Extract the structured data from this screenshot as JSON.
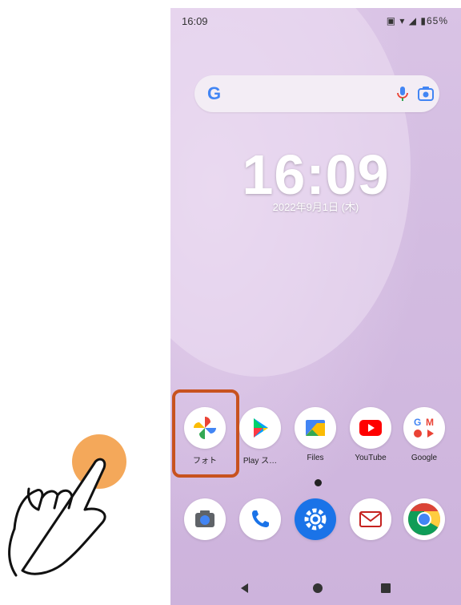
{
  "status_bar": {
    "time": "16:09",
    "battery": "65%"
  },
  "search_bar": {
    "logo_text": "G",
    "icons": [
      "mic-icon",
      "lens-camera-icon"
    ]
  },
  "clock": {
    "time": "16:09",
    "date": "2022年9月1日 (木)"
  },
  "dock_row1": [
    {
      "label": "フォト",
      "icon": "google-photos-icon"
    },
    {
      "label": "Play ス…",
      "icon": "play-store-icon"
    },
    {
      "label": "Files",
      "icon": "files-icon"
    },
    {
      "label": "YouTube",
      "icon": "youtube-icon"
    },
    {
      "label": "Google",
      "icon": "google-folder-icon"
    }
  ],
  "dock_row2": [
    {
      "icon": "camera-icon"
    },
    {
      "icon": "phone-icon"
    },
    {
      "icon": "settings-icon"
    },
    {
      "icon": "mail-icon"
    },
    {
      "icon": "chrome-icon"
    }
  ],
  "highlight_color": "#c8521f",
  "tap_indicator_color": "#f4a85a"
}
